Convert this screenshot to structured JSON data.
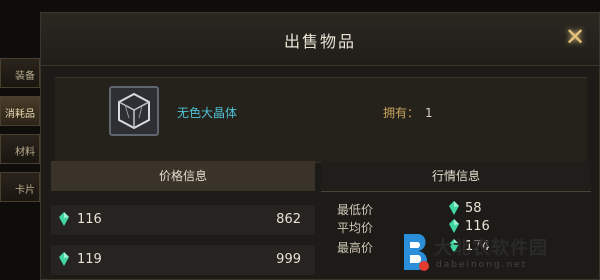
{
  "side_tabs": [
    {
      "label": "装备",
      "active": false
    },
    {
      "label": "消耗品",
      "active": true
    },
    {
      "label": "材料",
      "active": false
    },
    {
      "label": "卡片",
      "active": false
    }
  ],
  "dialog": {
    "title": "出售物品",
    "close_icon": "close-x-icon"
  },
  "item": {
    "icon": "crystal-cube-icon",
    "name": "无色大晶体",
    "owned_label": "拥有：",
    "owned_count": "1"
  },
  "price_info": {
    "header": "价格信息",
    "rows": [
      {
        "price": "116",
        "quantity": "862"
      },
      {
        "price": "119",
        "quantity": "999"
      }
    ]
  },
  "market_info": {
    "header": "行情信息",
    "rows": [
      {
        "label": "最低价",
        "value": "58"
      },
      {
        "label": "平均价",
        "value": "116"
      },
      {
        "label": "最高价",
        "value": "174"
      }
    ]
  },
  "watermark": {
    "text": "大北农软件园",
    "url": "dabeinong.net"
  },
  "colors": {
    "gem": "#3fd6a0",
    "item_name": "#4fc3d6",
    "owned_label": "#c8a25c",
    "panel_bg": "#1d1b17",
    "accent_gold": "#e6c27a"
  }
}
